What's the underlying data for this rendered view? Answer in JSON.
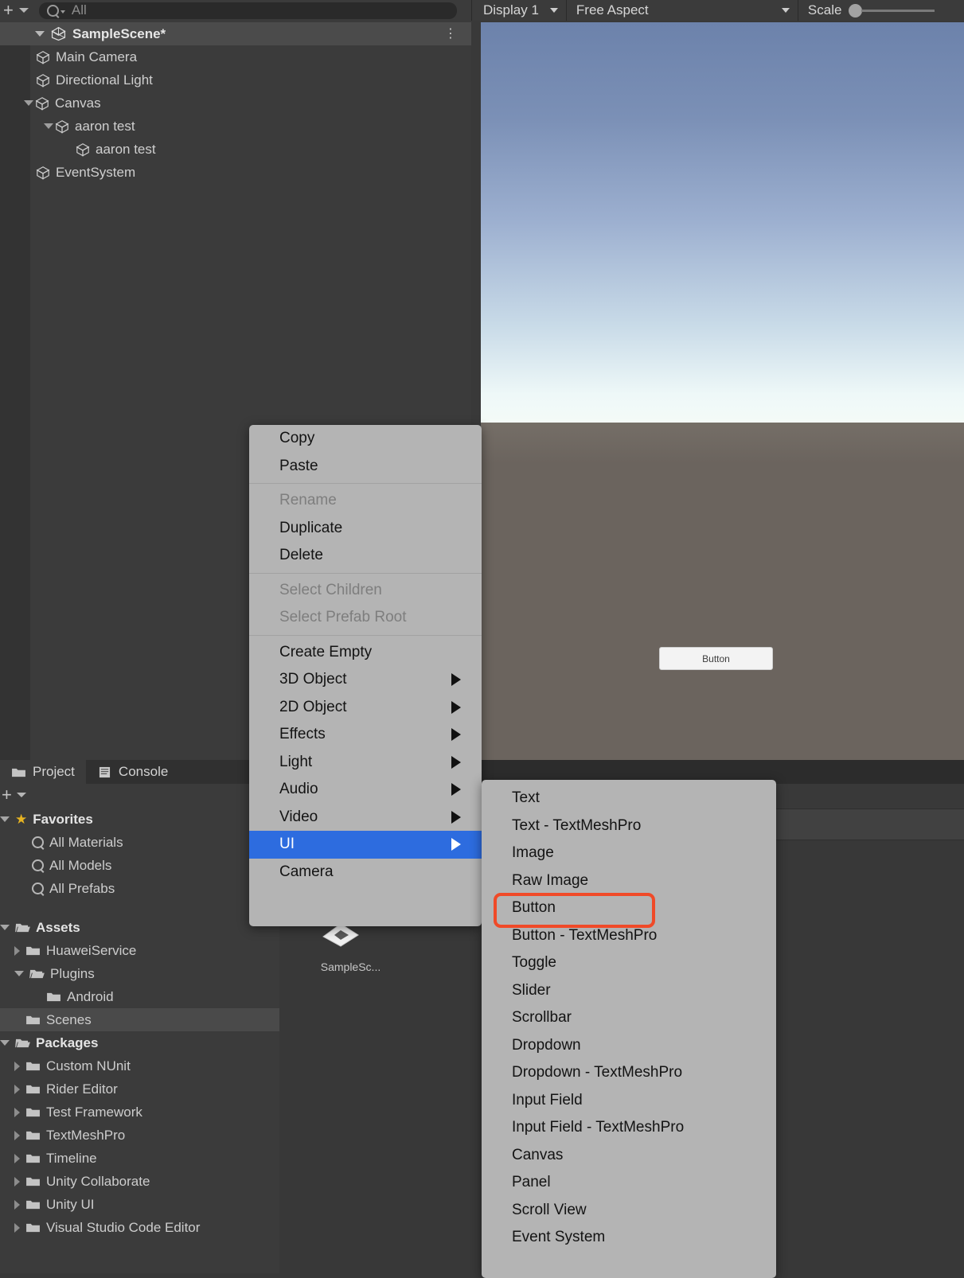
{
  "hierarchy": {
    "toolbar": {
      "add_label": "+",
      "search_placeholder": "All",
      "search_value": "All"
    },
    "scene": {
      "name": "SampleScene*",
      "expanded": true
    },
    "items": [
      {
        "label": "Main Camera",
        "depth": 1,
        "arrow": "none"
      },
      {
        "label": "Directional Light",
        "depth": 1,
        "arrow": "none"
      },
      {
        "label": "Canvas",
        "depth": 1,
        "arrow": "down"
      },
      {
        "label": "aaron test",
        "depth": 2,
        "arrow": "down"
      },
      {
        "label": "aaron test",
        "depth": 3,
        "arrow": "none"
      },
      {
        "label": "EventSystem",
        "depth": 1,
        "arrow": "none"
      }
    ]
  },
  "game_view": {
    "display_label": "Display 1",
    "aspect_label": "Free Aspect",
    "scale_label": "Scale",
    "button_label": "Button"
  },
  "project": {
    "tabs": [
      {
        "label": "Project",
        "icon": "folder-icon",
        "active": true
      },
      {
        "label": "Console",
        "icon": "console-icon",
        "active": false
      }
    ],
    "toolbar": {
      "add_label": "+"
    },
    "favorites": {
      "label": "Favorites",
      "items": [
        "All Materials",
        "All Models",
        "All Prefabs"
      ]
    },
    "assets": {
      "label": "Assets",
      "items": [
        {
          "label": "HuaweiService",
          "depth": 1,
          "arrow": "right",
          "selected": false
        },
        {
          "label": "Plugins",
          "depth": 1,
          "arrow": "down",
          "selected": false
        },
        {
          "label": "Android",
          "depth": 2,
          "arrow": "none",
          "selected": false
        },
        {
          "label": "Scenes",
          "depth": 1,
          "arrow": "none",
          "selected": true
        }
      ]
    },
    "packages": {
      "label": "Packages",
      "items": [
        "Custom NUnit",
        "Rider Editor",
        "Test Framework",
        "TextMeshPro",
        "Timeline",
        "Unity Collaborate",
        "Unity UI",
        "Visual Studio Code Editor"
      ]
    },
    "content": {
      "asset_label": "SampleSc..."
    }
  },
  "context_menu": {
    "groups": [
      [
        {
          "label": "Copy",
          "enabled": true,
          "submenu": false
        },
        {
          "label": "Paste",
          "enabled": true,
          "submenu": false
        }
      ],
      [
        {
          "label": "Rename",
          "enabled": false,
          "submenu": false
        },
        {
          "label": "Duplicate",
          "enabled": true,
          "submenu": false
        },
        {
          "label": "Delete",
          "enabled": true,
          "submenu": false
        }
      ],
      [
        {
          "label": "Select Children",
          "enabled": false,
          "submenu": false
        },
        {
          "label": "Select Prefab Root",
          "enabled": false,
          "submenu": false
        }
      ],
      [
        {
          "label": "Create Empty",
          "enabled": true,
          "submenu": false,
          "highlighted": false
        },
        {
          "label": "3D Object",
          "enabled": true,
          "submenu": true,
          "highlighted": false
        },
        {
          "label": "2D Object",
          "enabled": true,
          "submenu": true,
          "highlighted": false
        },
        {
          "label": "Effects",
          "enabled": true,
          "submenu": true,
          "highlighted": false
        },
        {
          "label": "Light",
          "enabled": true,
          "submenu": true,
          "highlighted": false
        },
        {
          "label": "Audio",
          "enabled": true,
          "submenu": true,
          "highlighted": false
        },
        {
          "label": "Video",
          "enabled": true,
          "submenu": true,
          "highlighted": false
        },
        {
          "label": "UI",
          "enabled": true,
          "submenu": true,
          "highlighted": true
        },
        {
          "label": "Camera",
          "enabled": true,
          "submenu": false,
          "highlighted": false
        }
      ]
    ]
  },
  "ui_submenu": {
    "items": [
      {
        "label": "Text",
        "annotated": false
      },
      {
        "label": "Text - TextMeshPro",
        "annotated": false
      },
      {
        "label": "Image",
        "annotated": false
      },
      {
        "label": "Raw Image",
        "annotated": false
      },
      {
        "label": "Button",
        "annotated": true
      },
      {
        "label": "Button - TextMeshPro",
        "annotated": false
      },
      {
        "label": "Toggle",
        "annotated": false
      },
      {
        "label": "Slider",
        "annotated": false
      },
      {
        "label": "Scrollbar",
        "annotated": false
      },
      {
        "label": "Dropdown",
        "annotated": false
      },
      {
        "label": "Dropdown - TextMeshPro",
        "annotated": false
      },
      {
        "label": "Input Field",
        "annotated": false
      },
      {
        "label": "Input Field - TextMeshPro",
        "annotated": false
      },
      {
        "label": "Canvas",
        "annotated": false
      },
      {
        "label": "Panel",
        "annotated": false
      },
      {
        "label": "Scroll View",
        "annotated": false
      },
      {
        "label": "Event System",
        "annotated": false
      }
    ]
  },
  "colors": {
    "menu_bg": "#b4b4b4",
    "menu_highlight": "#2d6cdf",
    "annotation": "#f04a28",
    "panel_bg": "#3b3b3b",
    "sky_top": "#6c82ab",
    "ground": "#6b645e",
    "favorites_star": "#e7b422"
  }
}
